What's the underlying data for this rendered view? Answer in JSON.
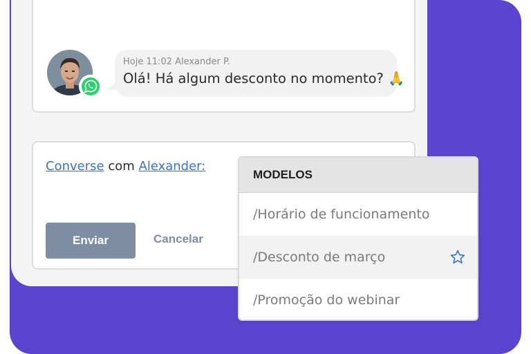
{
  "message": {
    "timestamp": "Hoje 11:02",
    "sender": "Alexander P.",
    "text": "Olá! Há algum desconto no momento? 🙏"
  },
  "reply": {
    "prefix_link": "Converse",
    "middle": "com",
    "recipient_link": "Alexander:",
    "send_label": "Enviar",
    "cancel_label": "Cancelar"
  },
  "templates": {
    "title": "MODELOS",
    "items": [
      {
        "label": "/Horário de funcionamento",
        "active": false
      },
      {
        "label": "/Desconto de março",
        "active": true,
        "icon": "star-icon"
      },
      {
        "label": "/Promoção do webinar",
        "active": false
      }
    ]
  },
  "colors": {
    "accent_purple": "#5b45cf",
    "link_blue": "#3a72c4",
    "button_gray": "#7f8da3",
    "whatsapp_green": "#25d366"
  }
}
